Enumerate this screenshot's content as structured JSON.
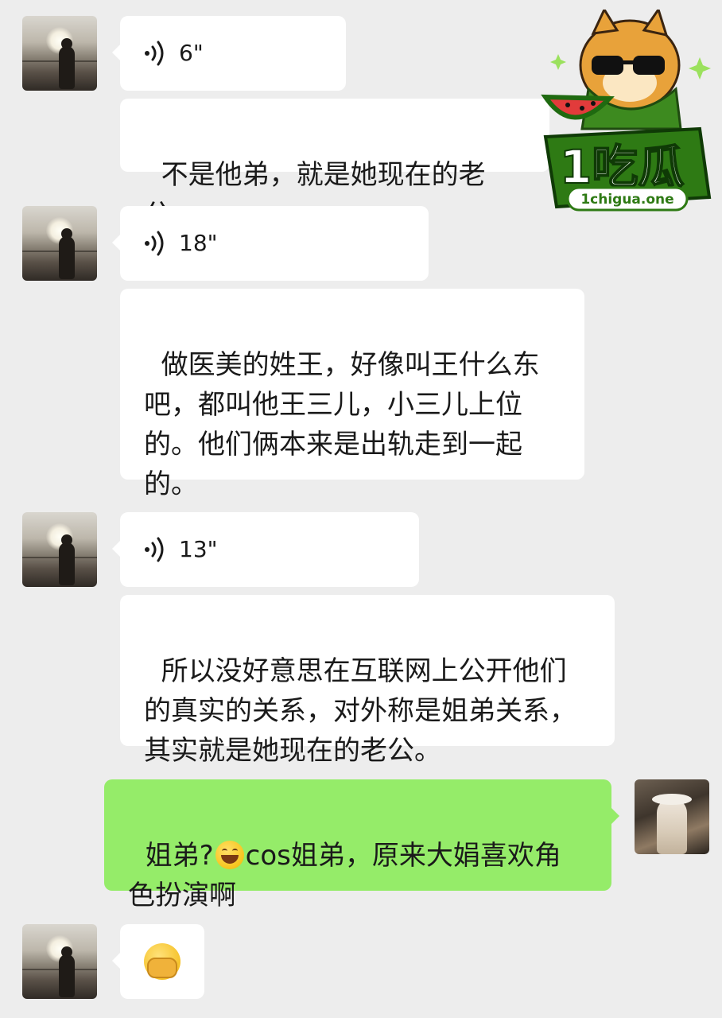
{
  "messages": [
    {
      "type": "voice",
      "duration": "6\""
    },
    {
      "type": "text",
      "text": "不是他弟，就是她现在的老公。"
    },
    {
      "type": "voice",
      "duration": "18\""
    },
    {
      "type": "text",
      "text": "做医美的姓王，好像叫王什么东吧，都叫他王三儿，小三儿上位的。他们俩本来是出轨走到一起的。"
    },
    {
      "type": "voice",
      "duration": "13\""
    },
    {
      "type": "text",
      "text": "所以没好意思在互联网上公开他们的真实的关系，对外称是姐弟关系，其实就是她现在的老公。"
    },
    {
      "type": "sent",
      "text_before": "姐弟?",
      "emoji": "grin-emoji",
      "text_after": "cos姐弟，原来大娟喜欢角色扮演啊"
    },
    {
      "type": "emoji",
      "emoji": "facepalm-emoji"
    }
  ],
  "watermark": {
    "brand": "1吃瓜",
    "domain": "1chigua.one"
  },
  "colors": {
    "background": "#ededed",
    "incoming_bubble": "#ffffff",
    "outgoing_bubble": "#95ec69",
    "logo_green": "#3d8a1f"
  }
}
